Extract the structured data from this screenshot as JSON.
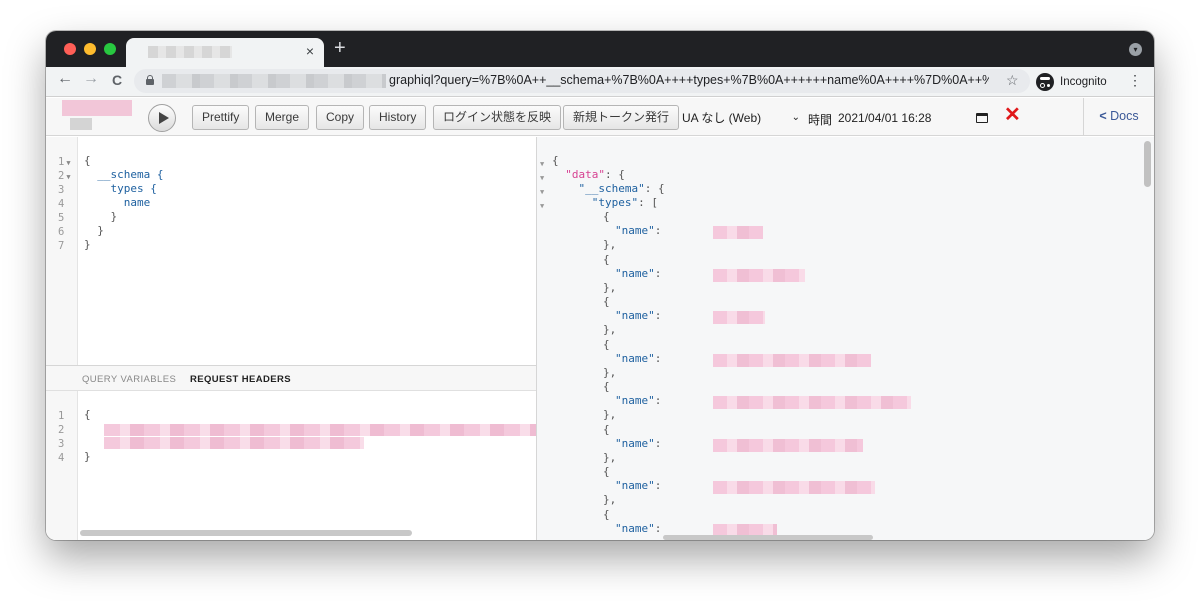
{
  "colors": {
    "traffic_close": "#ff5f57",
    "traffic_minimize": "#febc2e",
    "traffic_maximize": "#28c840",
    "tab_strip": "#202124",
    "json_key": "#1f61a0",
    "data_key": "#d64292",
    "clear_button": "#e0181a"
  },
  "browser": {
    "new_tab": "+",
    "close_tab": "×",
    "back": "←",
    "forward": "→",
    "reload": "C",
    "url_visible": "graphiql?query=%7B%0A++__schema+%7B%0A++++types+%7B%0A++++++name%0A++++%7D%0A++%...",
    "incognito_label": "Incognito",
    "star": "☆",
    "menu": "⋮"
  },
  "toolbar": {
    "execute_icon": "play-icon",
    "buttons": [
      "Prettify",
      "Merge",
      "Copy",
      "History",
      "ログイン状態を反映",
      "新規トークン発行"
    ],
    "ua_select": "UA なし (Web)",
    "time_label": "時間",
    "time_value": "2021/04/01 16:28",
    "clear": "✕",
    "docs_label": "Docs",
    "docs_chevron": "<"
  },
  "query_editor": {
    "line_numbers": [
      "1",
      "2",
      "3",
      "4",
      "5",
      "6",
      "7"
    ],
    "lines": [
      "{",
      "  __schema {",
      "    types {",
      "      name",
      "    }",
      "  }",
      "}"
    ]
  },
  "variables_panel": {
    "tabs": [
      "QUERY VARIABLES",
      "REQUEST HEADERS"
    ],
    "active_tab": "REQUEST HEADERS",
    "line_numbers": [
      "1",
      "2",
      "3",
      "4"
    ],
    "open_brace": "{",
    "close_brace": "}"
  },
  "result": {
    "open": "{",
    "data_key": "\"data\"",
    "schema_key": "\"__schema\"",
    "types_key": "\"types\"",
    "colon_brace": ": {",
    "colon_bracket": ": [",
    "name_key": "\"name\"",
    "colon": ":",
    "item_open": "{",
    "item_close": "},"
  }
}
